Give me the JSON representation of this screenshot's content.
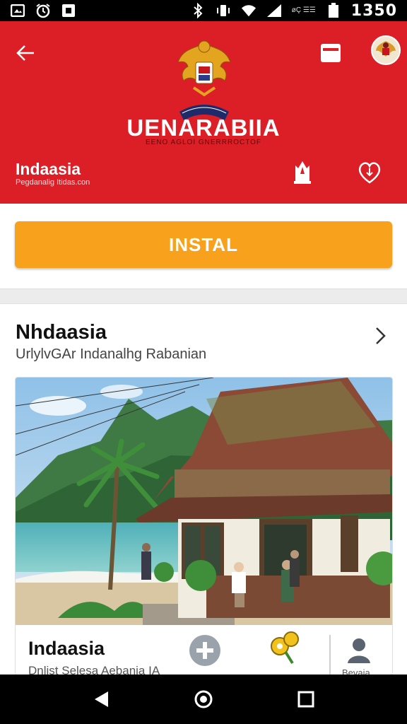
{
  "status_bar": {
    "time": "1350",
    "carrier_text": "øÇ ☰☰",
    "icons_left": [
      "image-icon",
      "alarm-icon",
      "screen-icon"
    ],
    "icons_right": [
      "bluetooth-icon",
      "vibrate-icon",
      "wifi-icon",
      "signal-icon",
      "battery-icon"
    ]
  },
  "header": {
    "title": "UENARABIIA",
    "subtitle": "EENO AGLOI GNERRROCTOF",
    "app_name": "Indaasia",
    "app_subtitle": "Pegdanalig Itidas.con",
    "background_color": "#dc1f26",
    "icons": [
      "back-arrow-icon",
      "emblem-icon",
      "cart-icon",
      "avatar",
      "crown-icon",
      "heart-icon"
    ]
  },
  "install": {
    "label": "INSTAL",
    "color": "#f7a11c"
  },
  "section": {
    "title": "Nhdaasia",
    "subtitle": "UrlylvGAr Indanalhg Rabanian"
  },
  "card": {
    "title": "Indaasia",
    "subtitle": "Dnlist Selesa Aebania IA",
    "person_label": "Bevaia",
    "icons": [
      "plus-icon",
      "key-icon",
      "person-icon"
    ]
  },
  "nav": {
    "icons": [
      "back-icon",
      "home-icon",
      "recents-icon"
    ]
  }
}
